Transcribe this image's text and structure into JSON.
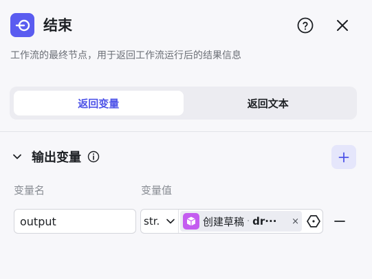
{
  "header": {
    "title": "结束",
    "description": "工作流的最终节点，用于返回工作流运行后的结果信息",
    "node_icon": "exit-node-icon",
    "help_icon": "help-circle-icon",
    "close_icon": "close-icon",
    "accent_color": "#5a5cf0"
  },
  "tabs": [
    {
      "label": "返回变量",
      "active": true
    },
    {
      "label": "返回文本",
      "active": false
    }
  ],
  "output_section": {
    "title": "输出变量",
    "columns": {
      "name": "变量名",
      "value": "变量值"
    },
    "rows": [
      {
        "name": "output",
        "type": "str.",
        "ref_node": "创建草稿",
        "ref_separator": "·",
        "ref_var": "dr···",
        "ref_remove": "×",
        "ref_icon_color": "#c45cf0"
      }
    ]
  }
}
